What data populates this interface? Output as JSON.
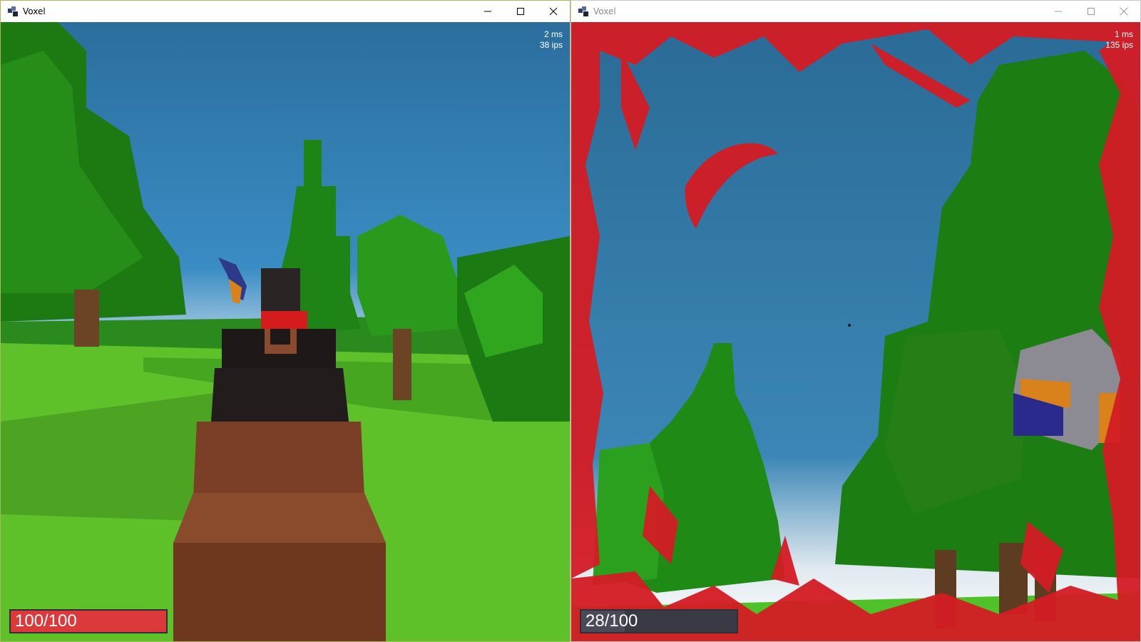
{
  "windows": [
    {
      "title": "Voxel",
      "stats": {
        "frame_time": "2 ms",
        "ips": "38 ips"
      },
      "health": {
        "label": "100/100",
        "fraction": 1.0
      },
      "colors": {
        "sky": "#2a7db0",
        "grass": "#5ec12a",
        "health_fill": "#dc3a3a"
      }
    },
    {
      "title": "Voxel",
      "stats": {
        "frame_time": "1 ms",
        "ips": "135 ips"
      },
      "health": {
        "label": "28/100",
        "fraction": 0.28
      },
      "colors": {
        "sky": "#2d6e98",
        "blood": "#d41c24",
        "health_fill": "#dc3a3a"
      }
    }
  ],
  "icons": {
    "app": "voxel-app-icon",
    "minimize": "minimize-icon",
    "maximize": "maximize-icon",
    "close": "close-icon"
  }
}
